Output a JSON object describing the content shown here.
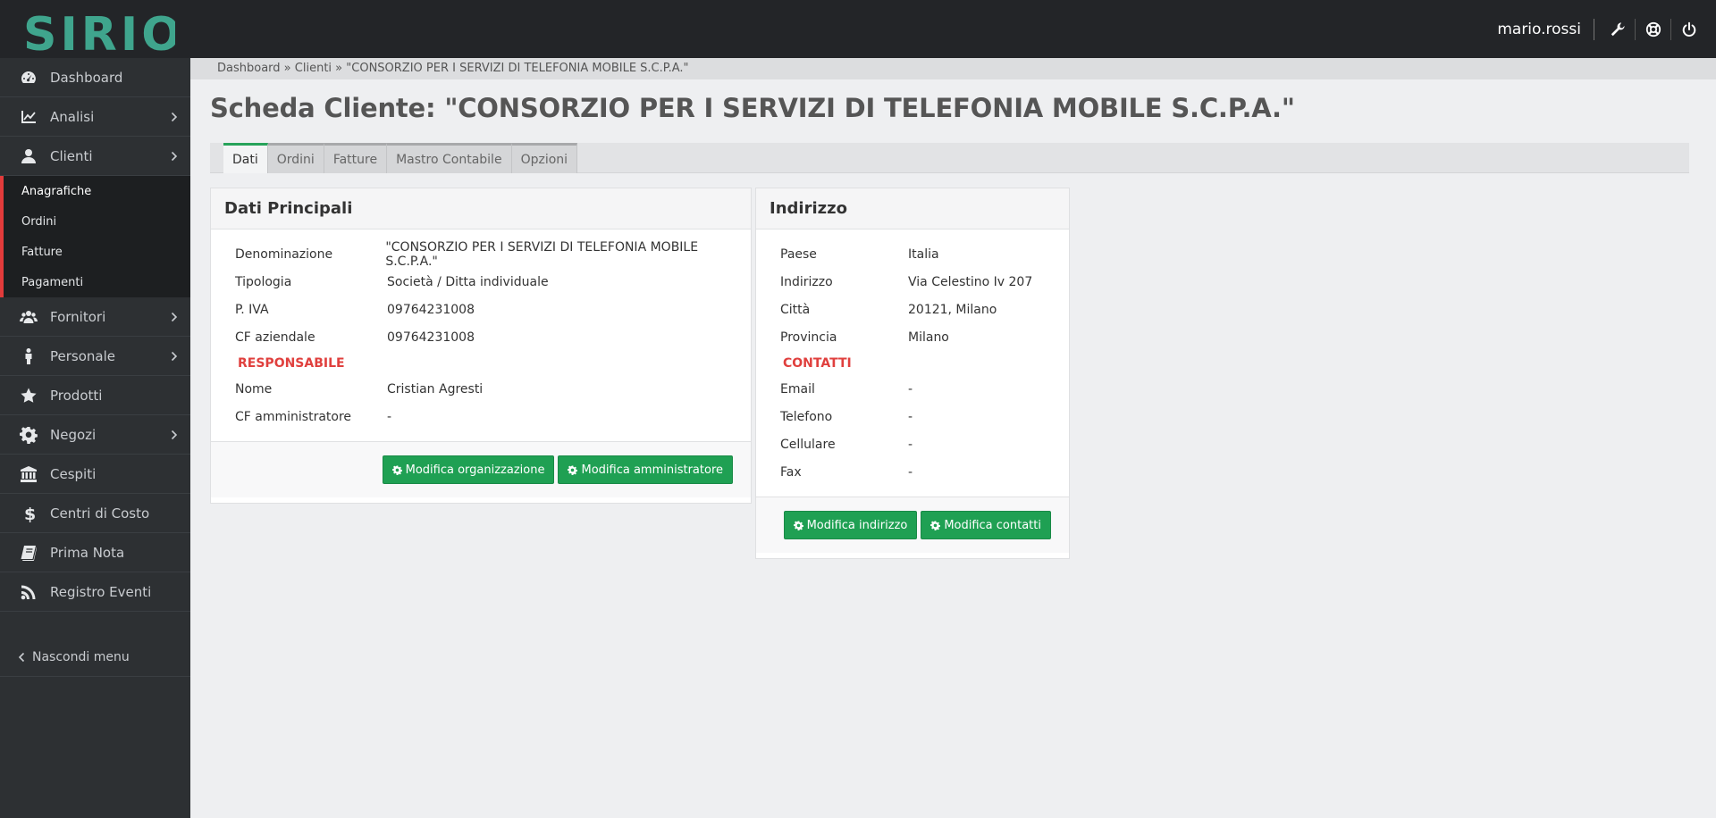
{
  "app": {
    "logo_text": "SIRIO",
    "username": "mario.rossi"
  },
  "topbar": {
    "icons": [
      "wrench-icon",
      "lifebuoy-icon",
      "power-icon"
    ]
  },
  "sidebar": {
    "items": [
      {
        "label": "Dashboard",
        "icon": "dashboard-icon",
        "has_children": false
      },
      {
        "label": "Analisi",
        "icon": "chart-line-icon",
        "has_children": true
      },
      {
        "label": "Clienti",
        "icon": "user-icon",
        "has_children": true
      },
      {
        "label": "Fornitori",
        "icon": "users-icon",
        "has_children": true
      },
      {
        "label": "Personale",
        "icon": "person-icon",
        "has_children": true
      },
      {
        "label": "Prodotti",
        "icon": "star-icon",
        "has_children": false
      },
      {
        "label": "Negozi",
        "icon": "gear-icon",
        "has_children": true
      },
      {
        "label": "Cespiti",
        "icon": "bank-icon",
        "has_children": false
      },
      {
        "label": "Centri di Costo",
        "icon": "dollar-icon",
        "has_children": false
      },
      {
        "label": "Prima Nota",
        "icon": "book-icon",
        "has_children": false
      },
      {
        "label": "Registro Eventi",
        "icon": "rss-icon",
        "has_children": false
      }
    ],
    "clienti_submenu": [
      "Anagrafiche",
      "Ordini",
      "Fatture",
      "Pagamenti"
    ],
    "hide_menu": "Nascondi menu"
  },
  "breadcrumb": {
    "items": [
      "Dashboard",
      "Clienti",
      "\"CONSORZIO PER I SERVIZI DI TELEFONIA MOBILE S.C.P.A.\""
    ],
    "separator": "»"
  },
  "page": {
    "title": "Scheda Cliente: \"CONSORZIO PER I SERVIZI DI TELEFONIA MOBILE S.C.P.A.\""
  },
  "tabs": [
    "Dati",
    "Ordini",
    "Fatture",
    "Mastro Contabile",
    "Opzioni"
  ],
  "panel_main": {
    "title": "Dati Principali",
    "rows": [
      {
        "label": "Denominazione",
        "value": "\"CONSORZIO PER I SERVIZI DI TELEFONIA MOBILE S.C.P.A.\""
      },
      {
        "label": "Tipologia",
        "value": "Società / Ditta individuale"
      },
      {
        "label": "P. IVA",
        "value": "09764231008"
      },
      {
        "label": "CF aziendale",
        "value": "09764231008"
      }
    ],
    "section": "RESPONSABILE",
    "rows2": [
      {
        "label": "Nome",
        "value": "Cristian Agresti"
      },
      {
        "label": "CF amministratore",
        "value": "-"
      }
    ],
    "buttons": [
      "Modifica organizzazione",
      "Modifica amministratore"
    ]
  },
  "panel_address": {
    "title": "Indirizzo",
    "rows": [
      {
        "label": "Paese",
        "value": "Italia"
      },
      {
        "label": "Indirizzo",
        "value": "Via Celestino Iv 207"
      },
      {
        "label": "Città",
        "value": "20121, Milano"
      },
      {
        "label": "Provincia",
        "value": "Milano"
      }
    ],
    "section": "CONTATTI",
    "rows2": [
      {
        "label": "Email",
        "value": "-"
      },
      {
        "label": "Telefono",
        "value": "-"
      },
      {
        "label": "Cellulare",
        "value": "-"
      },
      {
        "label": "Fax",
        "value": "-"
      }
    ],
    "buttons": [
      "Modifica indirizzo",
      "Modifica contatti"
    ]
  },
  "colors": {
    "accent_green": "#1fa053",
    "section_red": "#e0403e",
    "sidebar_bg": "#2d3033",
    "topbar_bg": "#232528",
    "logo_teal": "#3fa58d"
  }
}
